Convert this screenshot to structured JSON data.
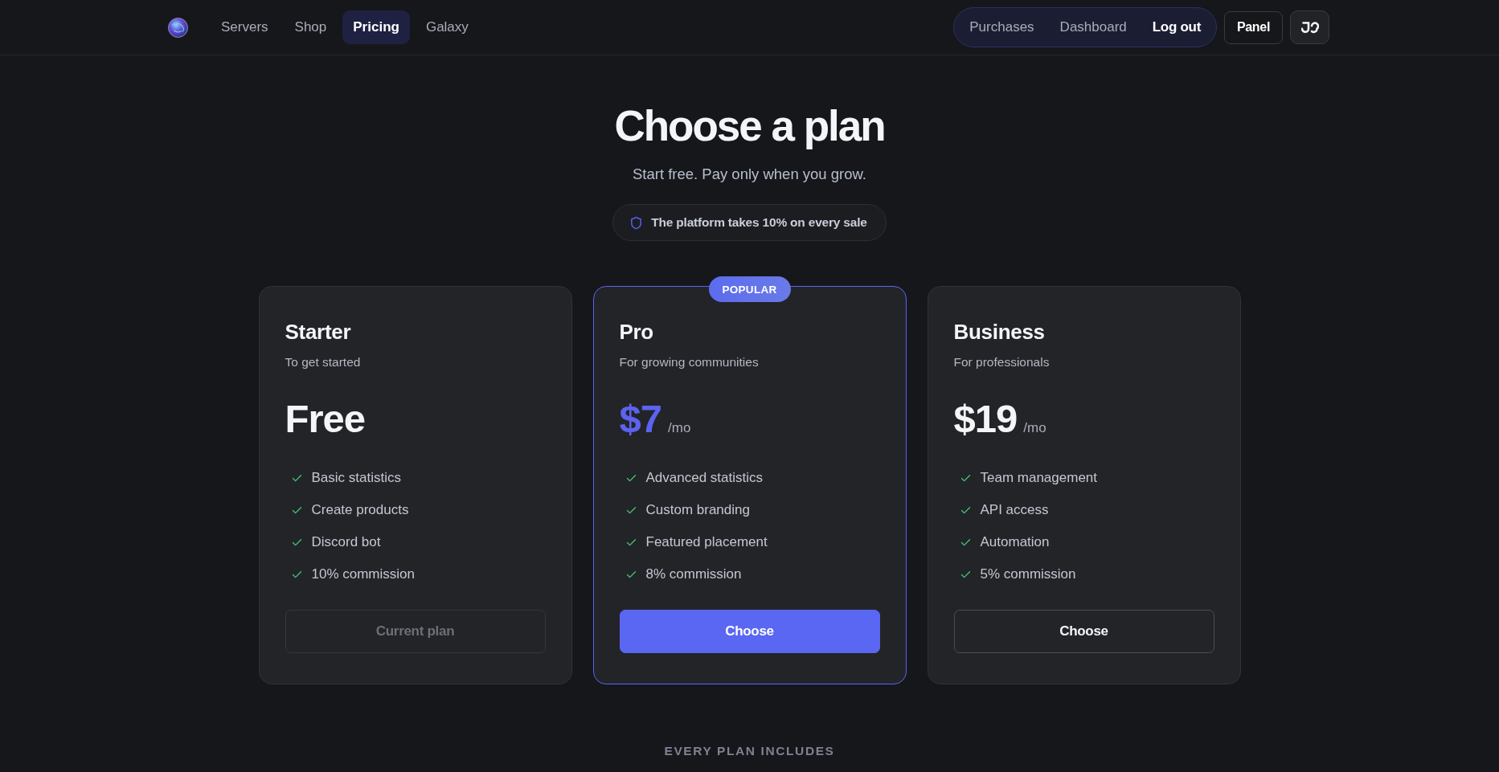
{
  "nav": {
    "links": [
      {
        "label": "Servers",
        "selected": false
      },
      {
        "label": "Shop",
        "selected": false
      },
      {
        "label": "Pricing",
        "selected": true
      },
      {
        "label": "Galaxy",
        "selected": false
      }
    ],
    "account_links": [
      {
        "label": "Purchases",
        "kind": "link"
      },
      {
        "label": "Dashboard",
        "kind": "link"
      },
      {
        "label": "Log out",
        "kind": "action"
      }
    ],
    "panel_button": "Panel"
  },
  "hero": {
    "title": "Choose a plan",
    "subtitle": "Start free. Pay only when you grow.",
    "notice": "The platform takes 10% on every sale"
  },
  "plans": [
    {
      "name": "Starter",
      "tagline": "To get started",
      "price": "Free",
      "highlighted": false,
      "features": [
        "Basic statistics",
        "Create products",
        "Discord bot",
        "10% commission"
      ],
      "button": {
        "label": "Current plan",
        "kind": "current"
      }
    },
    {
      "name": "Pro",
      "tagline": "For growing communities",
      "price": "$7",
      "period": "/mo",
      "highlighted": true,
      "badge": "POPULAR",
      "features": [
        "Advanced statistics",
        "Custom branding",
        "Featured placement",
        "8% commission"
      ],
      "button": {
        "label": "Choose",
        "kind": "primary"
      }
    },
    {
      "name": "Business",
      "tagline": "For professionals",
      "price": "$19",
      "period": "/mo",
      "highlighted": false,
      "features": [
        "Team management",
        "API access",
        "Automation",
        "5% commission"
      ],
      "button": {
        "label": "Choose",
        "kind": "outline"
      }
    }
  ],
  "includes": {
    "heading": "EVERY PLAN INCLUDES"
  }
}
